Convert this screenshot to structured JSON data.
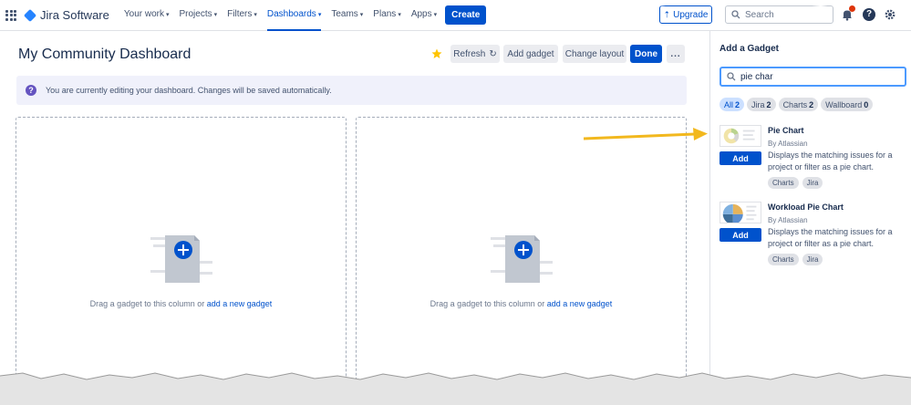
{
  "topnav": {
    "logo": "Jira Software",
    "items": [
      {
        "label": "Your work"
      },
      {
        "label": "Projects"
      },
      {
        "label": "Filters"
      },
      {
        "label": "Dashboards"
      },
      {
        "label": "Teams"
      },
      {
        "label": "Plans"
      },
      {
        "label": "Apps"
      }
    ],
    "active_item": "Dashboards",
    "create_label": "Create",
    "upgrade_label": "Upgrade",
    "search_placeholder": "Search",
    "accent_color": "#0052cc"
  },
  "dashboard": {
    "title": "My Community Dashboard",
    "buttons": {
      "refresh": "Refresh",
      "add_gadget": "Add gadget",
      "change_layout": "Change layout",
      "done": "Done",
      "more": "..."
    },
    "info_message": "You are currently editing your dashboard. Changes will be saved automatically.",
    "columns": [
      {
        "text": "Drag a gadget to this column or ",
        "link": "add a new gadget"
      },
      {
        "text": "Drag a gadget to this column or ",
        "link": "add a new gadget"
      }
    ]
  },
  "panel": {
    "title": "Add a Gadget",
    "search_value": "pie char",
    "filters": [
      {
        "label": "All",
        "count": "2",
        "selected": true
      },
      {
        "label": "Jira",
        "count": "2"
      },
      {
        "label": "Charts",
        "count": "2"
      },
      {
        "label": "Wallboard",
        "count": "0"
      }
    ],
    "gadgets": [
      {
        "name": "Pie Chart",
        "by": "By Atlassian",
        "description": "Displays the matching issues for a project or filter as a pie chart.",
        "add_label": "Add",
        "tags": [
          "Charts",
          "Jira"
        ]
      },
      {
        "name": "Workload Pie Chart",
        "by": "By Atlassian",
        "description": "Displays the matching issues for a project or filter as a pie chart.",
        "add_label": "Add",
        "tags": [
          "Charts",
          "Jira"
        ]
      }
    ]
  }
}
